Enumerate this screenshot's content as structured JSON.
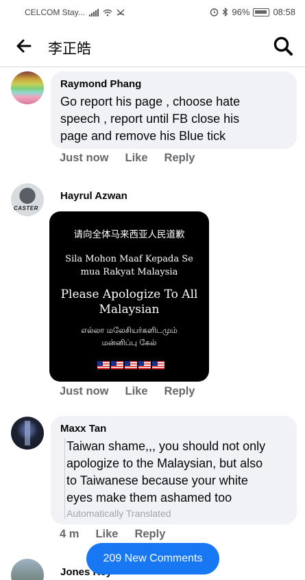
{
  "status_bar": {
    "carrier": "CELCOM Stay...",
    "battery": "96%",
    "time": "08:58"
  },
  "header": {
    "title": "李正皓"
  },
  "comments": [
    {
      "author": "Raymond Phang",
      "text_lines": [
        "Go report his page , choose hate",
        "speech , report until FB close his",
        "page and remove his Blue tick"
      ],
      "time": "Just now",
      "like": "Like",
      "reply": "Reply"
    },
    {
      "author": "Hayrul Azwan",
      "avatar_tag": "CASTER",
      "image": {
        "zh": "请向全体马来西亚人民道歉",
        "ms_lines": [
          "Sila Mohon Maaf Kepada Se",
          "mua Rakyat Malaysia"
        ],
        "en_lines": [
          "Please Apologize To All",
          "Malaysian"
        ],
        "ta_lines": [
          "எல்லா மலேசியர்களிடமும்",
          "மன்னிப்பு கேல்"
        ],
        "flag_count": 5
      },
      "time": "Just now",
      "like": "Like",
      "reply": "Reply"
    },
    {
      "author": "Maxx Tan",
      "text_lines": [
        "Taiwan shame,,, you should not only",
        "apologize to the Malaysian, but also",
        "to Taiwanese because your white",
        "eyes make them ashamed too"
      ],
      "translated_note": "Automatically Translated",
      "time": "4 m",
      "like": "Like",
      "reply": "Reply"
    },
    {
      "author": "Jones Key"
    }
  ],
  "new_comments_button": "209 New Comments",
  "colors": {
    "accent": "#1877f2",
    "bubble": "#f0f2f5",
    "secondary_text": "#65676b"
  }
}
